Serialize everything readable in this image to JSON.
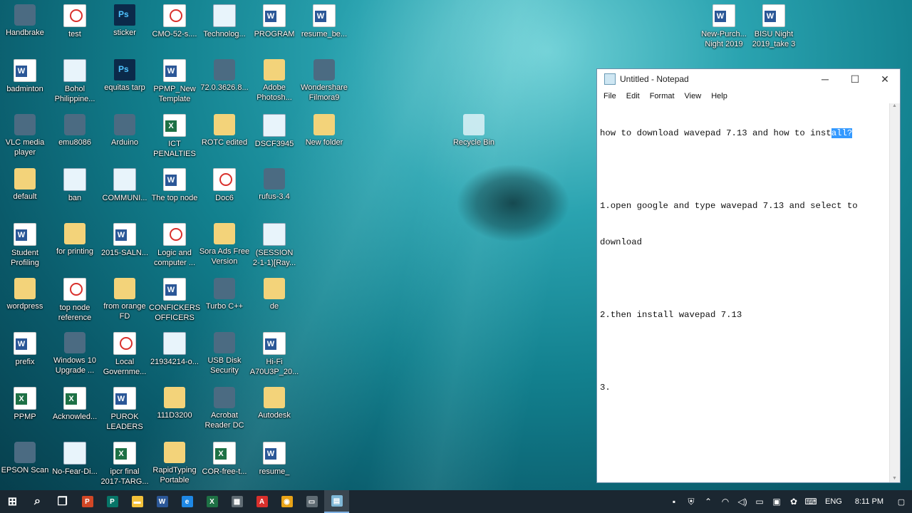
{
  "desktop": {
    "icons": [
      {
        "id": "i0",
        "label": "Handbrake",
        "kind": "app"
      },
      {
        "id": "i1",
        "label": "test",
        "kind": "pdf"
      },
      {
        "id": "i2",
        "label": "sticker",
        "kind": "psd"
      },
      {
        "id": "i3",
        "label": "CMO-52-s....",
        "kind": "pdf"
      },
      {
        "id": "i4",
        "label": "Technolog...",
        "kind": "img"
      },
      {
        "id": "i5",
        "label": "PROGRAM",
        "kind": "doc"
      },
      {
        "id": "i6",
        "label": "resume_be...",
        "kind": "doc"
      },
      {
        "id": "i7",
        "label": "New-Purch...\nNight 2019",
        "kind": "doc"
      },
      {
        "id": "i8",
        "label": "BISU Night\n2019_take 3",
        "kind": "doc"
      },
      {
        "id": "i9",
        "label": "badminton",
        "kind": "doc"
      },
      {
        "id": "i10",
        "label": "Bohol\nPhilippine...",
        "kind": "img"
      },
      {
        "id": "i11",
        "label": "equitas tarp",
        "kind": "psd"
      },
      {
        "id": "i12",
        "label": "PPMP_New\nTemplate",
        "kind": "doc"
      },
      {
        "id": "i13",
        "label": "72.0.3626.8...",
        "kind": "app"
      },
      {
        "id": "i14",
        "label": "Adobe\nPhotosh...",
        "kind": "folder"
      },
      {
        "id": "i15",
        "label": "Wondershare\nFilmora9",
        "kind": "app"
      },
      {
        "id": "i16",
        "label": "VLC media\nplayer",
        "kind": "app"
      },
      {
        "id": "i17",
        "label": "emu8086",
        "kind": "app"
      },
      {
        "id": "i18",
        "label": "Arduino",
        "kind": "app"
      },
      {
        "id": "i19",
        "label": "ICT\nPENALTIES",
        "kind": "xls"
      },
      {
        "id": "i20",
        "label": "ROTC edited",
        "kind": "folder"
      },
      {
        "id": "i21",
        "label": "DSCF3945",
        "kind": "img"
      },
      {
        "id": "i22",
        "label": "New folder",
        "kind": "folder"
      },
      {
        "id": "i23",
        "label": "Recycle Bin",
        "kind": "recycle"
      },
      {
        "id": "i24",
        "label": "default",
        "kind": "folder"
      },
      {
        "id": "i25",
        "label": "ban",
        "kind": "img"
      },
      {
        "id": "i26",
        "label": "COMMUNI...",
        "kind": "img"
      },
      {
        "id": "i27",
        "label": "The top node",
        "kind": "doc"
      },
      {
        "id": "i28",
        "label": "Doc6",
        "kind": "pdf"
      },
      {
        "id": "i29",
        "label": "rufus-3.4",
        "kind": "app"
      },
      {
        "id": "i30",
        "label": "Student\nProfiling",
        "kind": "doc"
      },
      {
        "id": "i31",
        "label": "for printing",
        "kind": "folder"
      },
      {
        "id": "i32",
        "label": "2015-SALN...",
        "kind": "doc"
      },
      {
        "id": "i33",
        "label": "Logic and\ncomputer ...",
        "kind": "pdf"
      },
      {
        "id": "i34",
        "label": "Sora Ads Free\nVersion",
        "kind": "folder"
      },
      {
        "id": "i35",
        "label": "(SESSION\n2-1-1)[Ray...",
        "kind": "img"
      },
      {
        "id": "i36",
        "label": "wordpress",
        "kind": "folder"
      },
      {
        "id": "i37",
        "label": "top node\nreference",
        "kind": "pdf"
      },
      {
        "id": "i38",
        "label": "from orange\nFD",
        "kind": "folder"
      },
      {
        "id": "i39",
        "label": "CONFICKERS\nOFFICERS",
        "kind": "doc"
      },
      {
        "id": "i40",
        "label": "Turbo C++",
        "kind": "app"
      },
      {
        "id": "i41",
        "label": "de",
        "kind": "folder"
      },
      {
        "id": "i42",
        "label": "prefix",
        "kind": "doc"
      },
      {
        "id": "i43",
        "label": "Windows 10\nUpgrade ...",
        "kind": "app"
      },
      {
        "id": "i44",
        "label": "Local\nGovernme...",
        "kind": "pdf"
      },
      {
        "id": "i45",
        "label": "21934214-o...",
        "kind": "img"
      },
      {
        "id": "i46",
        "label": "USB Disk\nSecurity",
        "kind": "app"
      },
      {
        "id": "i47",
        "label": "Hi-Fi\nA70U3P_20...",
        "kind": "doc"
      },
      {
        "id": "i48",
        "label": "PPMP",
        "kind": "xls"
      },
      {
        "id": "i49",
        "label": "Acknowled...",
        "kind": "xls"
      },
      {
        "id": "i50",
        "label": "PUROK\nLEADERS",
        "kind": "doc"
      },
      {
        "id": "i51",
        "label": "111D3200",
        "kind": "folder"
      },
      {
        "id": "i52",
        "label": "Acrobat\nReader DC",
        "kind": "app"
      },
      {
        "id": "i53",
        "label": "Autodesk",
        "kind": "folder"
      },
      {
        "id": "i54",
        "label": "EPSON Scan",
        "kind": "app"
      },
      {
        "id": "i55",
        "label": "No-Fear-Di...",
        "kind": "img"
      },
      {
        "id": "i56",
        "label": "ipcr final\n2017-TARG...",
        "kind": "xls"
      },
      {
        "id": "i57",
        "label": "RapidTyping\nPortable",
        "kind": "folder"
      },
      {
        "id": "i58",
        "label": "COR-free-t...",
        "kind": "xls"
      },
      {
        "id": "i59",
        "label": "resume_",
        "kind": "doc"
      }
    ]
  },
  "notepad": {
    "title": "Untitled - Notepad",
    "menu": [
      "File",
      "Edit",
      "Format",
      "View",
      "Help"
    ],
    "controls": {
      "minimize": "─",
      "maximize": "☐",
      "close": "✕"
    },
    "text": {
      "line1_before": "how to download wavepad 7.13 and how to inst",
      "line1_selected": "all?",
      "line2": "",
      "line3": "1.open google and type wavepad 7.13 and select to",
      "line4": "download",
      "line5": "",
      "line6": "2.then install wavepad 7.13",
      "line7": "",
      "line8": "3."
    }
  },
  "taskbar": {
    "items": [
      {
        "name": "start-button",
        "glyph": "⊞",
        "color": "#ffffff"
      },
      {
        "name": "search-icon",
        "glyph": "⌕",
        "color": "#ffffff"
      },
      {
        "name": "task-view-icon",
        "glyph": "❐",
        "color": "#ffffff"
      },
      {
        "name": "powerpoint-icon",
        "glyph": "P",
        "color": "#d24726"
      },
      {
        "name": "publisher-icon",
        "glyph": "P",
        "color": "#077568"
      },
      {
        "name": "file-explorer-icon",
        "glyph": "▬",
        "color": "#f3c13a"
      },
      {
        "name": "word-icon",
        "glyph": "W",
        "color": "#2b5797"
      },
      {
        "name": "edge-icon",
        "glyph": "e",
        "color": "#1e88e5"
      },
      {
        "name": "excel-icon",
        "glyph": "X",
        "color": "#1e7145"
      },
      {
        "name": "calculator-icon",
        "glyph": "▦",
        "color": "#5f6b73"
      },
      {
        "name": "acrobat-icon",
        "glyph": "A",
        "color": "#d9302c"
      },
      {
        "name": "chrome-icon",
        "glyph": "◉",
        "color": "#e8a317"
      },
      {
        "name": "photos-icon",
        "glyph": "▭",
        "color": "#5f6b73"
      },
      {
        "name": "notepad-icon",
        "glyph": "▤",
        "color": "#7fb7d6"
      }
    ],
    "tray": {
      "language": "ENG",
      "time": "8:11 PM"
    }
  }
}
